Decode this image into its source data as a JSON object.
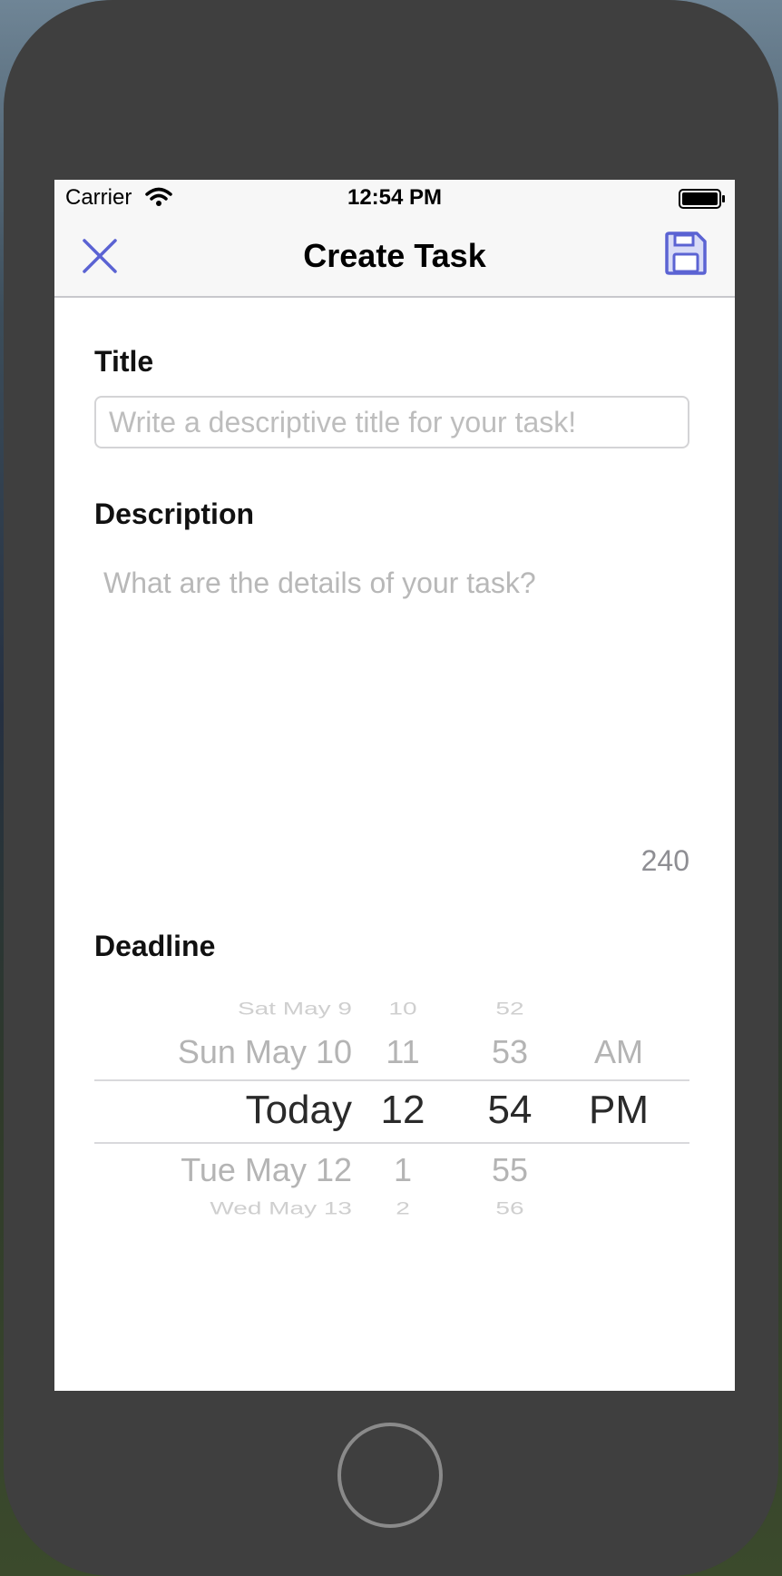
{
  "status_bar": {
    "carrier": "Carrier",
    "time": "12:54 PM"
  },
  "navbar": {
    "title": "Create Task",
    "close_icon": "close-icon",
    "save_icon": "floppy-disk-save-icon"
  },
  "form": {
    "title_label": "Title",
    "title_placeholder": "Write a descriptive title for your task!",
    "title_value": "",
    "description_label": "Description",
    "description_placeholder": "What are the details of your task?",
    "description_value": "",
    "char_counter": "240",
    "deadline_label": "Deadline"
  },
  "picker": {
    "rows": [
      {
        "day": "Sat May 9",
        "hour": "10",
        "minute": "52",
        "ampm": ""
      },
      {
        "day": "Sun May 10",
        "hour": "11",
        "minute": "53",
        "ampm": "AM"
      },
      {
        "day": "Today",
        "hour": "12",
        "minute": "54",
        "ampm": "PM"
      },
      {
        "day": "Tue May 12",
        "hour": "1",
        "minute": "55",
        "ampm": ""
      },
      {
        "day": "Wed May 13",
        "hour": "2",
        "minute": "56",
        "ampm": ""
      }
    ],
    "selected_index": 2
  },
  "colors": {
    "accent": "#5b63d3",
    "background": "#ffffff",
    "bar": "#f7f7f7",
    "device": "#3f3f3f"
  }
}
